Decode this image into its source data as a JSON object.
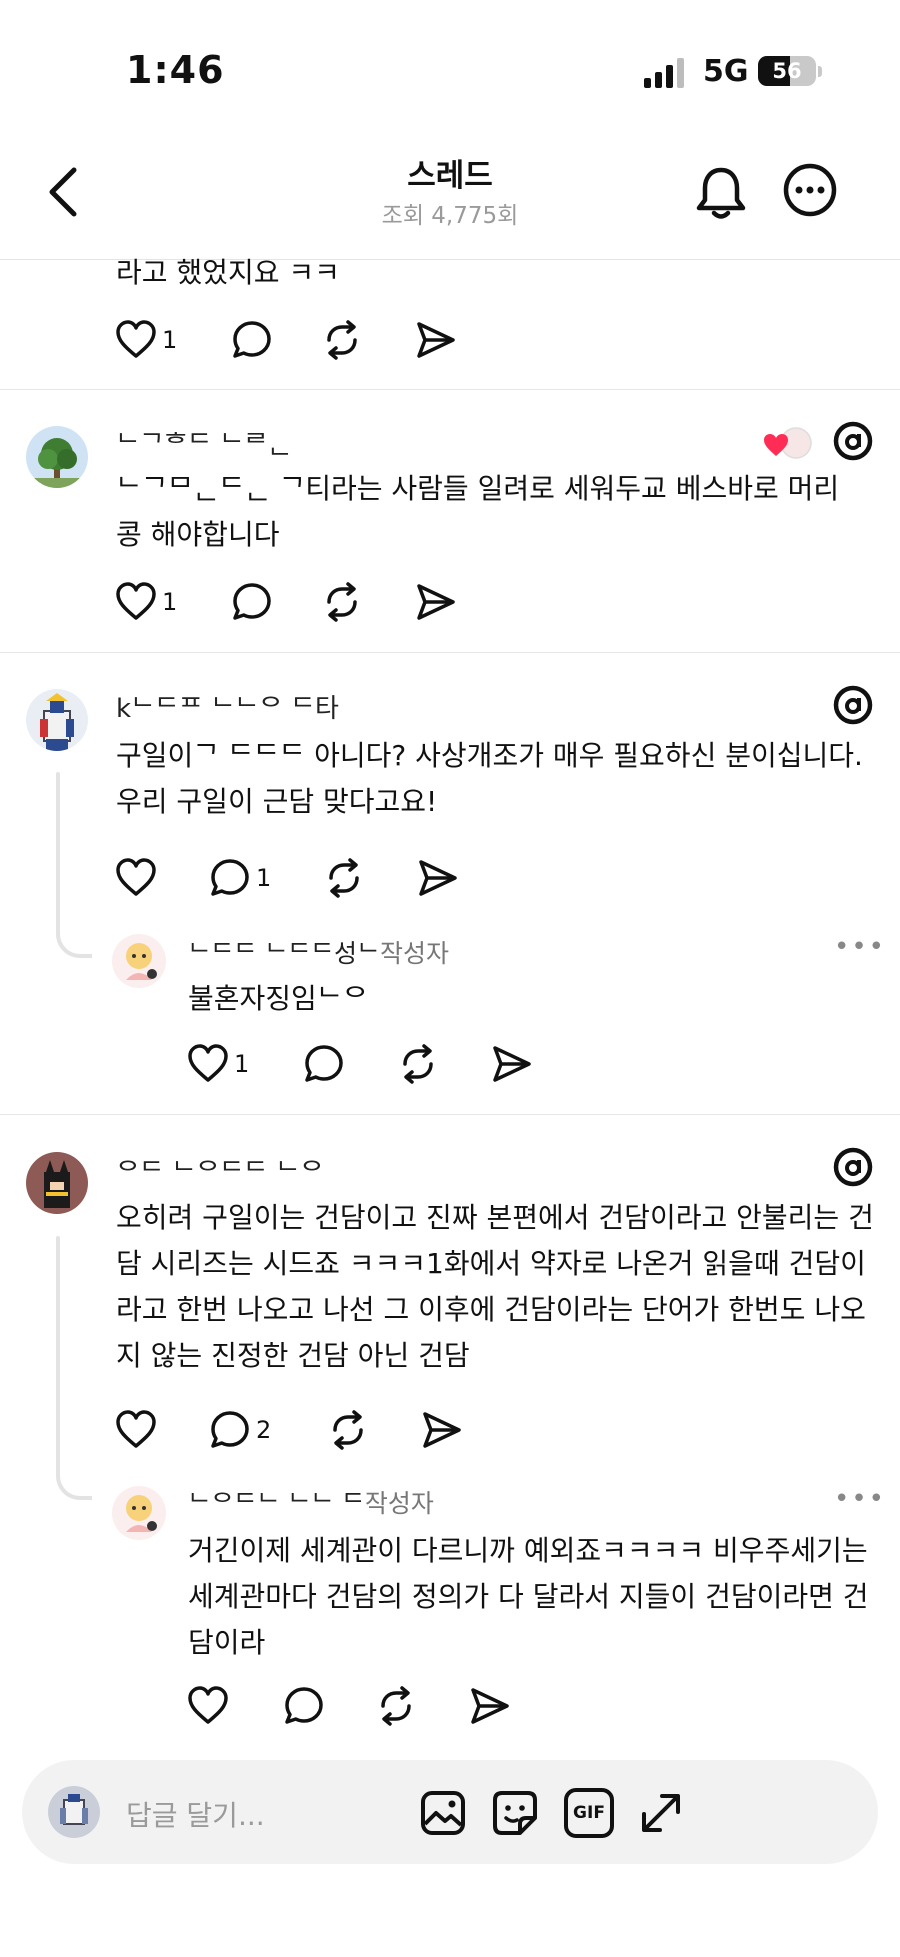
{
  "status_bar": {
    "time": "1:46",
    "network": "5G",
    "battery": "56",
    "battery_level": 0.56
  },
  "header": {
    "title": "스레드",
    "views": "조회 4,775회"
  },
  "posts": [
    {
      "text": "라고 했었지요 ㅋㅋ",
      "actions": {
        "like_count": "1",
        "comment_count": "",
        "repost": "",
        "share": ""
      }
    },
    {
      "author": "ᄂᄀᄒᄃ ᄂᄅᆫ",
      "text": "ᄂᄀᄆᆫᄃᆫ ᄀ티라는 사람들 일려로 세워두교 베스바로 머리 콩 해야합니다",
      "actions": {
        "like_count": "1",
        "comment_count": ""
      }
    },
    {
      "author": "kᄂᄃᄑ ᄂᄂᄋ ᄃ타",
      "text": "구일이ᄀ ᄃᄃᄃ 아니다?  사상개조가 매우 필요하신 분이십니다.  우리 구일이 근담 맞다고요!",
      "actions": {
        "like_count": "",
        "comment_count": "1"
      },
      "reply": {
        "author": "ᄂᄃᄃ ᄂᄃᄃ성ᄂ",
        "author_tag": "작성자",
        "text": "불혼자징임ᄂᄋ",
        "actions": {
          "like_count": "1",
          "comment_count": ""
        }
      }
    },
    {
      "author": "ᄋᄃ ᄂᄋᄃᄃ ᄂᄋ",
      "text": "오히려 구일이는 건담이고 진짜 본편에서 건담이라고 안불리는 건담 시리즈는 시드죠 ㅋㅋㅋ1화에서 약자로 나온거 읽을때 건담이라고 한번 나오고 나선 그 이후에 건담이라는 단어가 한번도 나오지 않는 진정한 건담 아닌 건담",
      "actions": {
        "like_count": "",
        "comment_count": "2"
      },
      "reply": {
        "author": "ᄂᄋᄃᄂ ᄂᄂ ᄃ",
        "author_tag": "작성자",
        "text": "거긴이제 세계관이 다르니까 예외죠ㅋㅋㅋㅋ 비우주세기는 세계관마다 건담의 정의가 다 달라서 지들이 건담이라면 건담이라",
        "actions": {
          "like_count": "",
          "comment_count": ""
        }
      }
    }
  ],
  "reply_bar": {
    "placeholder": "답글 달기...",
    "gif_label": "GIF"
  },
  "icons": [
    "back-icon",
    "bell-icon",
    "more-icon",
    "heart-icon",
    "comment-icon",
    "repost-icon",
    "share-icon",
    "threads-icon",
    "image-icon",
    "sticker-icon",
    "gif-icon",
    "expand-icon"
  ]
}
